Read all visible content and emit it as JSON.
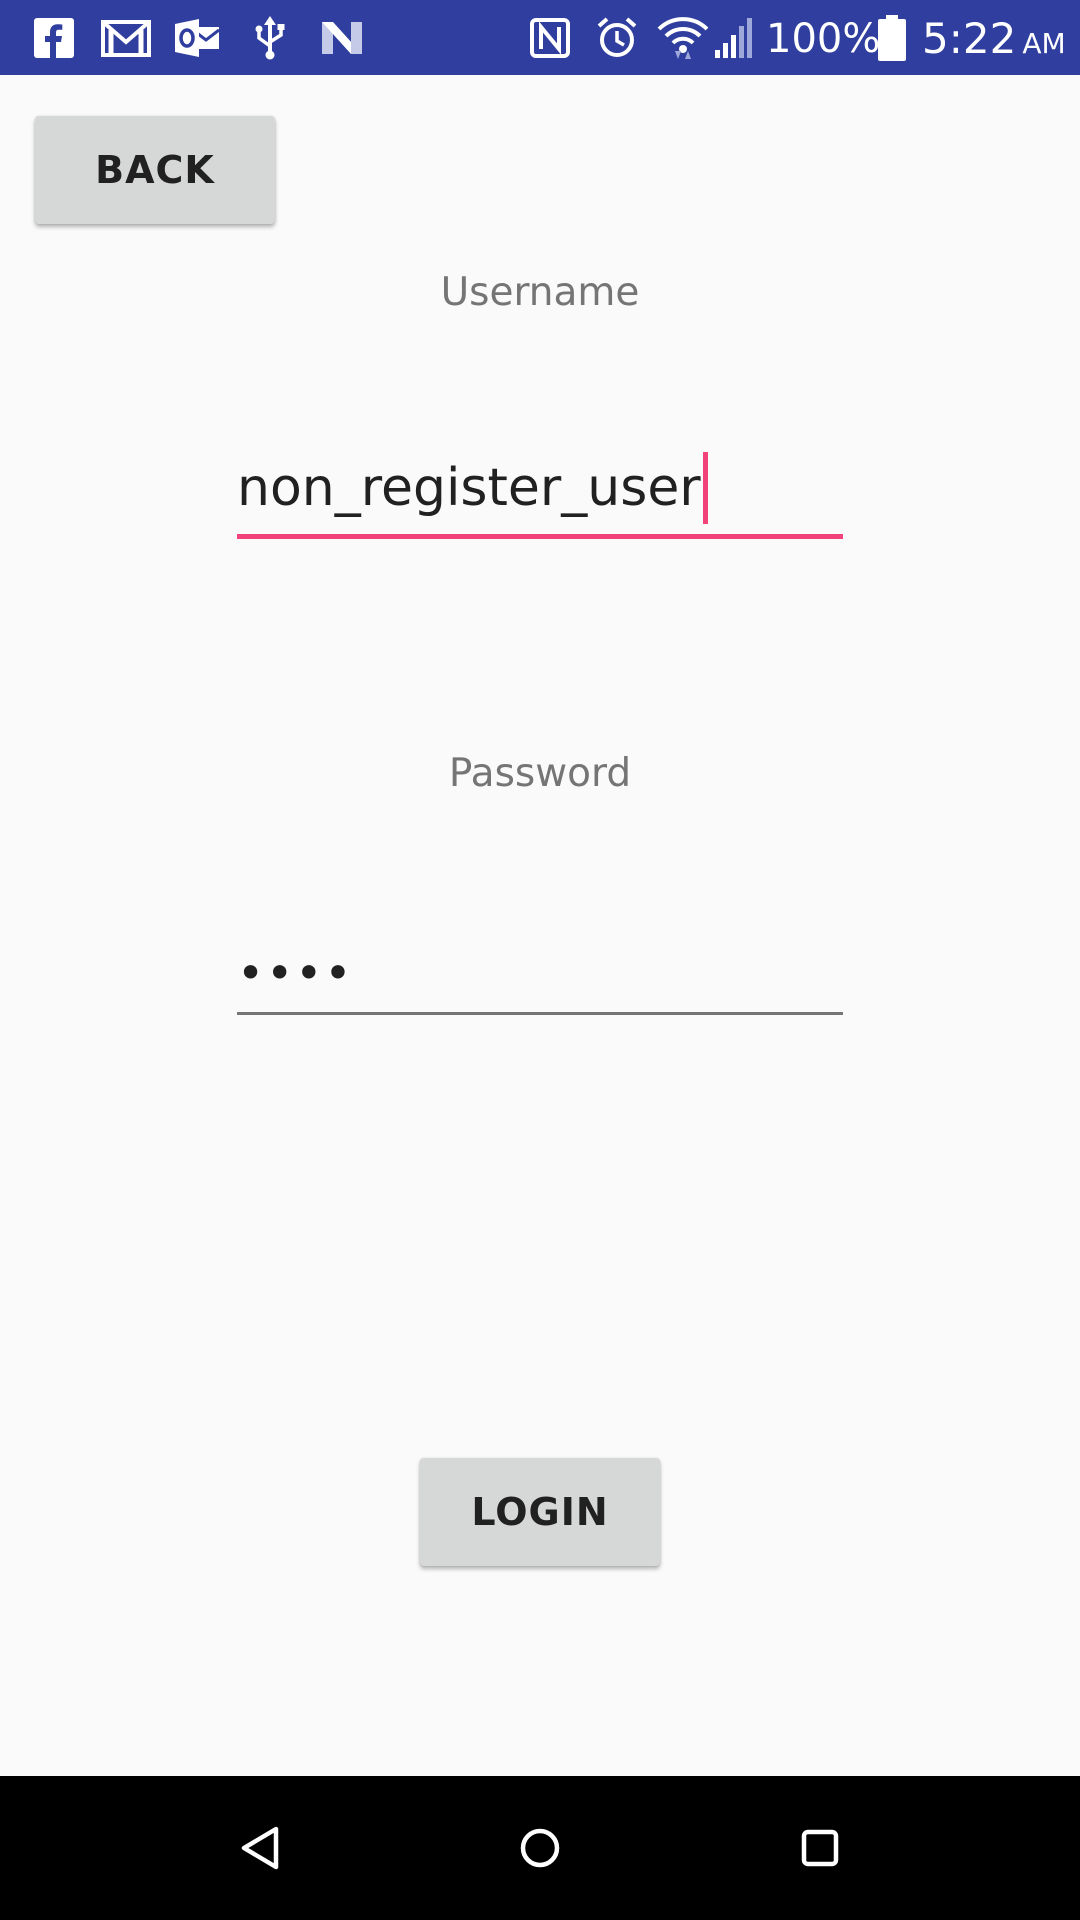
{
  "status_bar": {
    "notification_icons": [
      "facebook-icon",
      "gmail-icon",
      "outlook-icon",
      "usb-icon",
      "n-app-icon"
    ],
    "system_icons": [
      "nfc-icon",
      "alarm-icon",
      "wifi-icon",
      "signal-icon",
      "battery-icon"
    ],
    "battery_percent": "100%",
    "time": "5:22",
    "ampm": "AM",
    "background_color": "#303f9f"
  },
  "screen": {
    "back_button_label": "BACK",
    "username": {
      "label": "Username",
      "value": "non_register_user",
      "focused": true,
      "accent_color": "#f2427a"
    },
    "password": {
      "label": "Password",
      "masked_value": "••••"
    },
    "login_button_label": "LOGIN"
  },
  "nav_bar": {
    "buttons": [
      "back-triangle-icon",
      "home-circle-icon",
      "recents-square-icon"
    ]
  }
}
